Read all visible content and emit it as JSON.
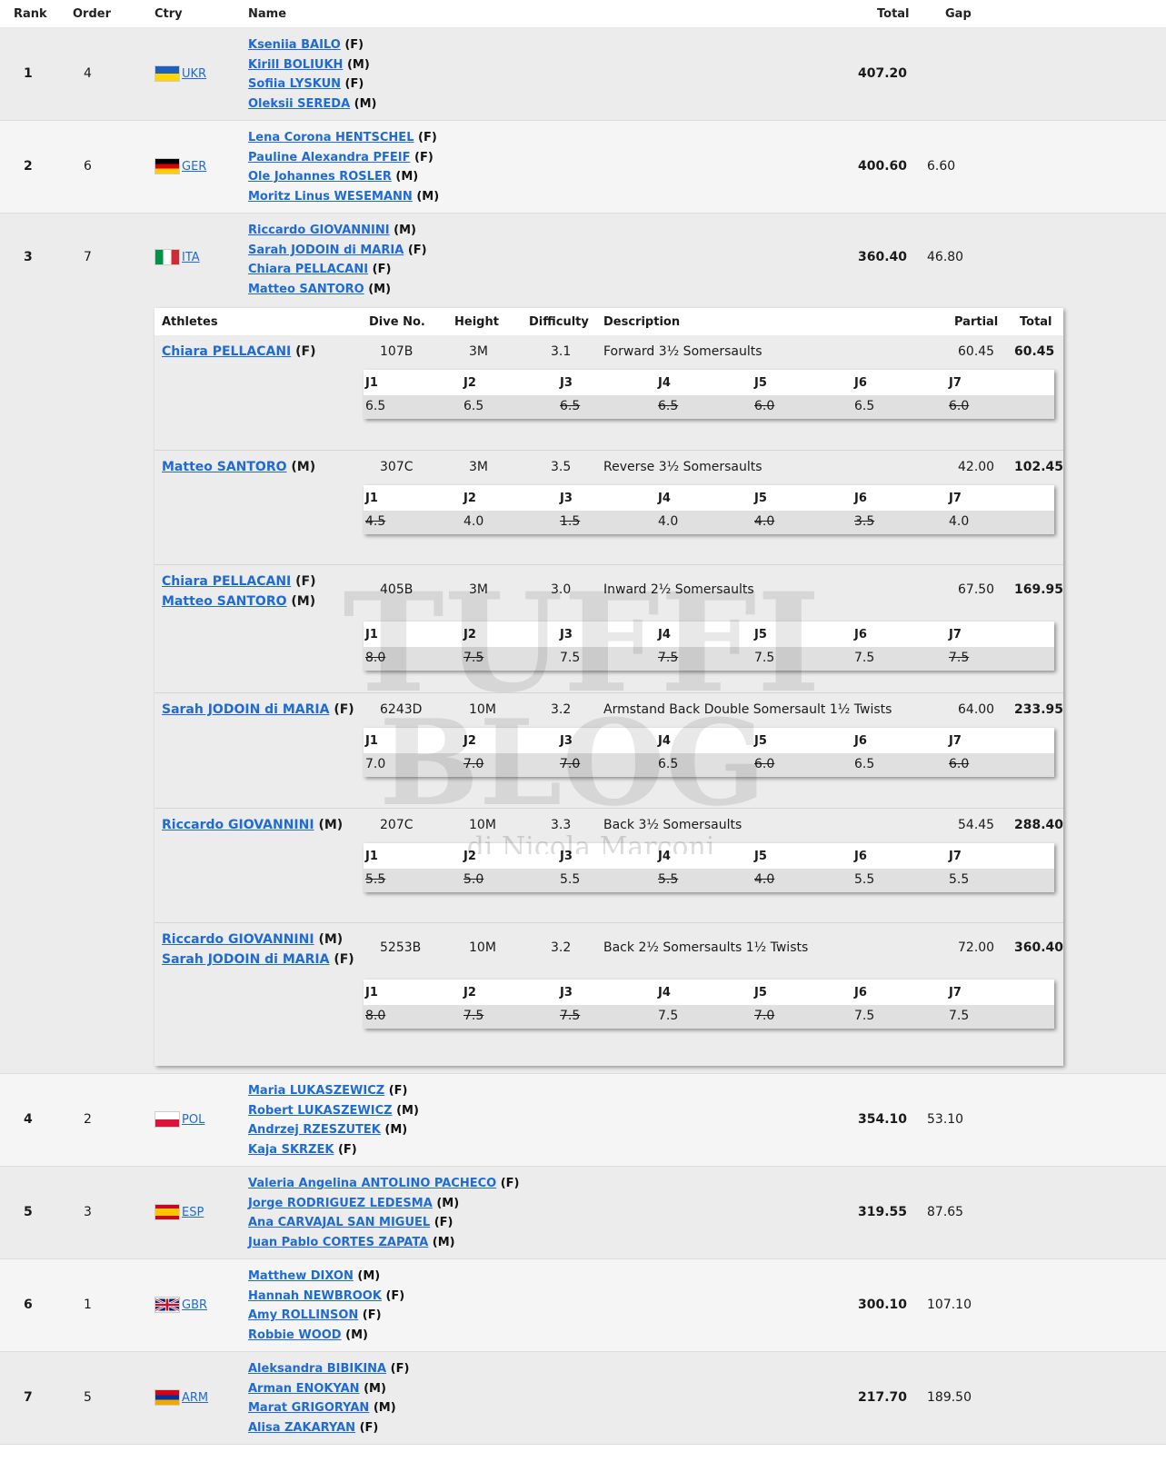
{
  "header": {
    "rank": "Rank",
    "order": "Order",
    "ctry": "Ctry",
    "name": "Name",
    "total": "Total",
    "gap": "Gap"
  },
  "teams": [
    {
      "rank": "1",
      "order": "4",
      "ctry": "UKR",
      "total": "407.20",
      "gap": "",
      "athletes": [
        [
          "Kseniia BAILO",
          "(F)"
        ],
        [
          "Kirill BOLIUKH",
          "(M)"
        ],
        [
          "Sofiia LYSKUN",
          "(F)"
        ],
        [
          "Oleksii SEREDA",
          "(M)"
        ]
      ]
    },
    {
      "rank": "2",
      "order": "6",
      "ctry": "GER",
      "total": "400.60",
      "gap": "6.60",
      "athletes": [
        [
          "Lena Corona HENTSCHEL",
          "(F)"
        ],
        [
          "Pauline Alexandra PFEIF",
          "(F)"
        ],
        [
          "Ole Johannes ROSLER",
          "(M)"
        ],
        [
          "Moritz Linus WESEMANN",
          "(M)"
        ]
      ]
    },
    {
      "rank": "3",
      "order": "7",
      "ctry": "ITA",
      "total": "360.40",
      "gap": "46.80",
      "athletes": [
        [
          "Riccardo GIOVANNINI",
          "(M)"
        ],
        [
          "Sarah JODOIN di MARIA",
          "(F)"
        ],
        [
          "Chiara PELLACANI",
          "(F)"
        ],
        [
          "Matteo SANTORO",
          "(M)"
        ]
      ]
    },
    {
      "rank": "4",
      "order": "2",
      "ctry": "POL",
      "total": "354.10",
      "gap": "53.10",
      "athletes": [
        [
          "Maria LUKASZEWICZ",
          "(F)"
        ],
        [
          "Robert LUKASZEWICZ",
          "(M)"
        ],
        [
          "Andrzej RZESZUTEK",
          "(M)"
        ],
        [
          "Kaja SKRZEK",
          "(F)"
        ]
      ]
    },
    {
      "rank": "5",
      "order": "3",
      "ctry": "ESP",
      "total": "319.55",
      "gap": "87.65",
      "athletes": [
        [
          "Valeria Angelina ANTOLINO PACHECO",
          "(F)"
        ],
        [
          "Jorge RODRIGUEZ LEDESMA",
          "(M)"
        ],
        [
          "Ana CARVAJAL SAN MIGUEL",
          "(F)"
        ],
        [
          "Juan Pablo CORTES ZAPATA",
          "(M)"
        ]
      ]
    },
    {
      "rank": "6",
      "order": "1",
      "ctry": "GBR",
      "total": "300.10",
      "gap": "107.10",
      "athletes": [
        [
          "Matthew DIXON",
          "(M)"
        ],
        [
          "Hannah NEWBROOK",
          "(F)"
        ],
        [
          "Amy ROLLINSON",
          "(F)"
        ],
        [
          "Robbie WOOD",
          "(M)"
        ]
      ]
    },
    {
      "rank": "7",
      "order": "5",
      "ctry": "ARM",
      "total": "217.70",
      "gap": "189.50",
      "athletes": [
        [
          "Aleksandra BIBIKINA",
          "(F)"
        ],
        [
          "Arman ENOKYAN",
          "(M)"
        ],
        [
          "Marat GRIGORYAN",
          "(M)"
        ],
        [
          "Alisa ZAKARYAN",
          "(F)"
        ]
      ]
    }
  ],
  "detail": {
    "headers": {
      "athletes": "Athletes",
      "dive": "Dive No.",
      "height": "Height",
      "difficulty": "Difficulty",
      "description": "Description",
      "partial": "Partial",
      "total": "Total"
    },
    "judge_labels": [
      "J1",
      "J2",
      "J3",
      "J4",
      "J5",
      "J6",
      "J7"
    ],
    "dives": [
      {
        "athletes": [
          [
            "Chiara PELLACANI",
            "(F)"
          ]
        ],
        "dive": "107B",
        "height": "3M",
        "difficulty": "3.1",
        "description": "Forward 3½ Somersaults",
        "partial": "60.45",
        "total": "60.45",
        "scores": [
          "6.5",
          "6.5",
          "6.5",
          "6.5",
          "6.0",
          "6.5",
          "6.0"
        ],
        "struck": [
          false,
          false,
          true,
          true,
          true,
          false,
          true
        ]
      },
      {
        "athletes": [
          [
            "Matteo SANTORO",
            "(M)"
          ]
        ],
        "dive": "307C",
        "height": "3M",
        "difficulty": "3.5",
        "description": "Reverse 3½ Somersaults",
        "partial": "42.00",
        "total": "102.45",
        "scores": [
          "4.5",
          "4.0",
          "1.5",
          "4.0",
          "4.0",
          "3.5",
          "4.0"
        ],
        "struck": [
          true,
          false,
          true,
          false,
          true,
          true,
          false
        ]
      },
      {
        "athletes": [
          [
            "Chiara PELLACANI",
            "(F)"
          ],
          [
            "Matteo SANTORO",
            "(M)"
          ]
        ],
        "dive": "405B",
        "height": "3M",
        "difficulty": "3.0",
        "description": "Inward 2½ Somersaults",
        "partial": "67.50",
        "total": "169.95",
        "scores": [
          "8.0",
          "7.5",
          "7.5",
          "7.5",
          "7.5",
          "7.5",
          "7.5"
        ],
        "struck": [
          true,
          true,
          false,
          true,
          false,
          false,
          true
        ]
      },
      {
        "athletes": [
          [
            "Sarah JODOIN di MARIA",
            "(F)"
          ]
        ],
        "dive": "6243D",
        "height": "10M",
        "difficulty": "3.2",
        "description": "Armstand Back Double Somersault 1½ Twists",
        "partial": "64.00",
        "total": "233.95",
        "scores": [
          "7.0",
          "7.0",
          "7.0",
          "6.5",
          "6.0",
          "6.5",
          "6.0"
        ],
        "struck": [
          false,
          true,
          true,
          false,
          true,
          false,
          true
        ]
      },
      {
        "athletes": [
          [
            "Riccardo GIOVANNINI",
            "(M)"
          ]
        ],
        "dive": "207C",
        "height": "10M",
        "difficulty": "3.3",
        "description": "Back 3½ Somersaults",
        "partial": "54.45",
        "total": "288.40",
        "scores": [
          "5.5",
          "5.0",
          "5.5",
          "5.5",
          "4.0",
          "5.5",
          "5.5"
        ],
        "struck": [
          true,
          true,
          false,
          true,
          true,
          false,
          false
        ]
      },
      {
        "athletes": [
          [
            "Riccardo GIOVANNINI",
            "(M)"
          ],
          [
            "Sarah JODOIN di MARIA",
            "(F)"
          ]
        ],
        "dive": "5253B",
        "height": "10M",
        "difficulty": "3.2",
        "description": "Back 2½ Somersaults 1½ Twists",
        "partial": "72.00",
        "total": "360.40",
        "scores": [
          "8.0",
          "7.5",
          "7.5",
          "7.5",
          "7.0",
          "7.5",
          "7.5"
        ],
        "struck": [
          true,
          true,
          true,
          false,
          true,
          false,
          false
        ]
      }
    ]
  },
  "watermark": {
    "line1": "TUFFI",
    "line2": "BLOG",
    "line3": "di Nicola Marconi"
  },
  "flags": {
    "UKR": [
      "#1d5fbf",
      "#ffd500"
    ],
    "GER": [
      "#000000",
      "#dd0000",
      "#ffce00"
    ],
    "ITA": [
      "#009246",
      "#ffffff",
      "#ce2b37"
    ],
    "POL": [
      "#ffffff",
      "#dc143c"
    ],
    "ESP": [
      "#c60b1e",
      "#ffc400",
      "#c60b1e"
    ],
    "ARM": [
      "#d90012",
      "#0033a0",
      "#f2a800"
    ]
  }
}
